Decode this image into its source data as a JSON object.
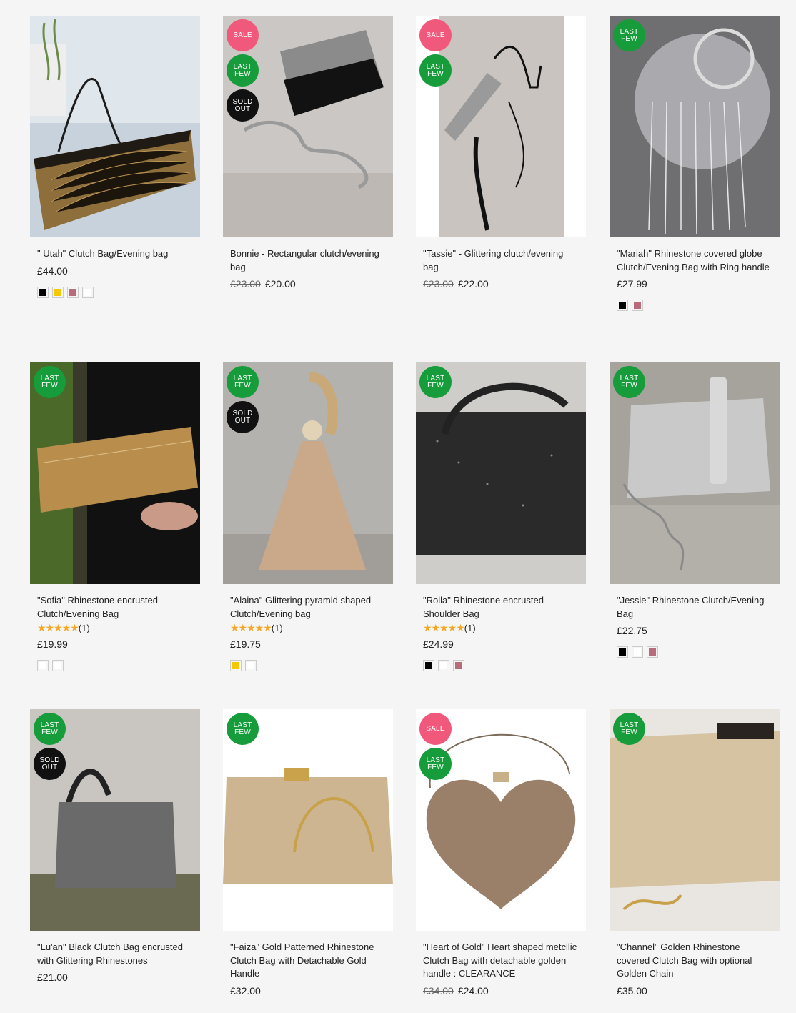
{
  "badges": {
    "sale": "SALE",
    "last_few_1": "LAST",
    "last_few_2": "FEW",
    "sold_out_1": "SOLD",
    "sold_out_2": "OUT"
  },
  "products": [
    {
      "title": "\" Utah\" Clutch Bag/Evening bag",
      "price": "£44.00",
      "old_price": "",
      "rating_count": "",
      "swatches": [
        "#000000",
        "#f5c800",
        "#b86b7a",
        "#ffffff"
      ]
    },
    {
      "title": "Bonnie - Rectangular clutch/evening bag",
      "price": "£20.00",
      "old_price": "£23.00",
      "rating_count": "",
      "swatches": []
    },
    {
      "title": "\"Tassie\" - Glittering clutch/evening bag",
      "price": "£22.00",
      "old_price": "£23.00",
      "rating_count": "",
      "swatches": []
    },
    {
      "title": "\"Mariah\" Rhinestone covered globe Clutch/Evening Bag with Ring handle",
      "price": "£27.99",
      "old_price": "",
      "rating_count": "",
      "swatches": [
        "#000000",
        "#b86b7a"
      ]
    },
    {
      "title": "\"Sofia\" Rhinestone encrusted Clutch/Evening Bag",
      "price": "£19.99",
      "old_price": "",
      "rating_count": "(1)",
      "swatches": [
        "#ffffff",
        "#ffffff"
      ]
    },
    {
      "title": "\"Alaina\" Glittering pyramid shaped Clutch/Evening bag",
      "price": "£19.75",
      "old_price": "",
      "rating_count": "(1)",
      "swatches": [
        "#f5c800",
        "#ffffff"
      ]
    },
    {
      "title": "\"Rolla\" Rhinestone encrusted Shoulder Bag",
      "price": "£24.99",
      "old_price": "",
      "rating_count": "(1)",
      "swatches": [
        "#000000",
        "#ffffff",
        "#b86b7a"
      ]
    },
    {
      "title": "\"Jessie\" Rhinestone Clutch/Evening Bag",
      "price": "£22.75",
      "old_price": "",
      "rating_count": "",
      "swatches": [
        "#000000",
        "#ffffff",
        "#b86b7a"
      ]
    },
    {
      "title": "\"Lu'an\" Black Clutch Bag encrusted with Glittering Rhinestones",
      "price": "£21.00",
      "old_price": "",
      "rating_count": "",
      "swatches": []
    },
    {
      "title": "\"Faiza\" Gold Patterned Rhinestone Clutch Bag with Detachable Gold Handle",
      "price": "£32.00",
      "old_price": "",
      "rating_count": "",
      "swatches": []
    },
    {
      "title": "\"Heart of Gold\" Heart shaped metcllic Clutch Bag with detachable golden handle : CLEARANCE",
      "price": "£24.00",
      "old_price": "£34.00",
      "rating_count": "",
      "swatches": []
    },
    {
      "title": "\"Channel\" Golden Rhinestone covered Clutch Bag with optional Golden Chain",
      "price": "£35.00",
      "old_price": "",
      "rating_count": "",
      "swatches": []
    }
  ],
  "colors": {
    "sale": "#f0597b",
    "last_few": "#169c3a",
    "sold_out": "#111111",
    "star": "#f5a623"
  }
}
